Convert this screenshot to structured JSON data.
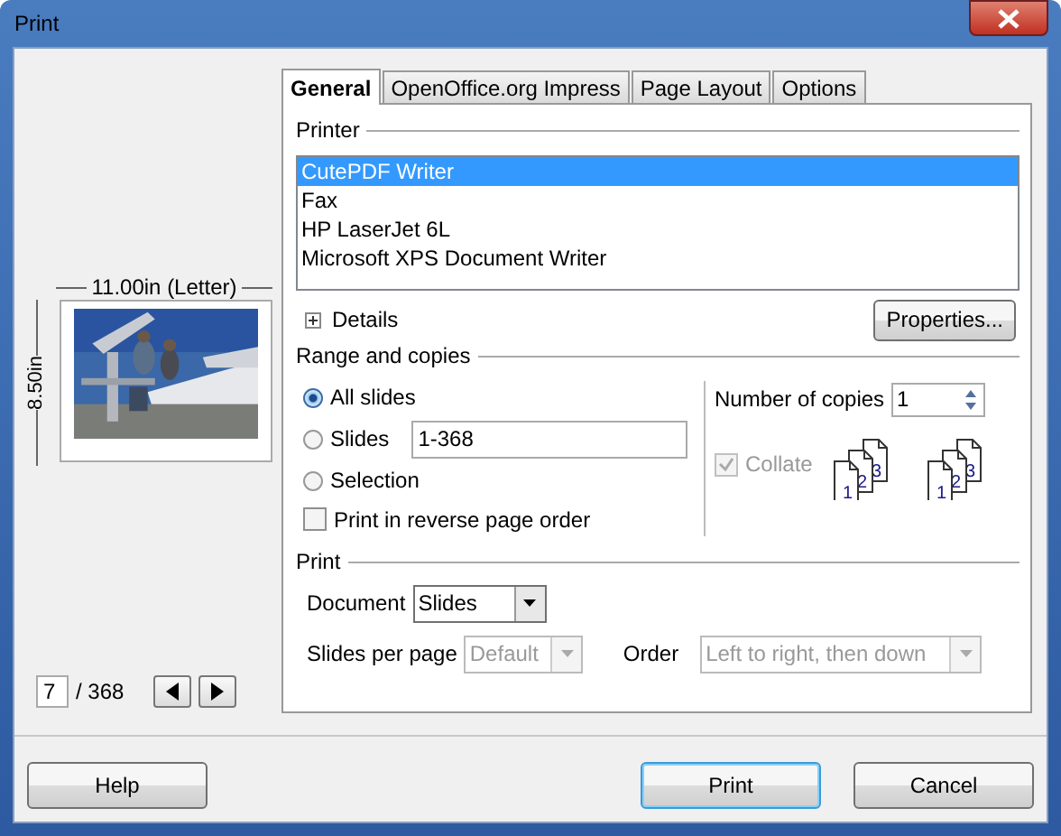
{
  "window": {
    "title": "Print"
  },
  "preview": {
    "width_label": "11.00in (Letter)",
    "height_label": "8.50in",
    "page_number": "7",
    "page_total": "/ 368"
  },
  "tabs": [
    {
      "label": "General",
      "selected": true
    },
    {
      "label": "OpenOffice.org Impress",
      "selected": false
    },
    {
      "label": "Page Layout",
      "selected": false
    },
    {
      "label": "Options",
      "selected": false
    }
  ],
  "printer": {
    "heading": "Printer",
    "printers": [
      {
        "name": "CutePDF Writer",
        "selected": true
      },
      {
        "name": "Fax",
        "selected": false
      },
      {
        "name": "HP LaserJet 6L",
        "selected": false
      },
      {
        "name": "Microsoft XPS Document Writer",
        "selected": false
      }
    ],
    "details": "Details",
    "properties_button": "Properties..."
  },
  "range": {
    "heading": "Range and copies",
    "options": [
      {
        "kind": "radio",
        "label": "All slides",
        "selected": true
      },
      {
        "kind": "radio",
        "label": "Slides",
        "selected": false,
        "value": "1-368"
      },
      {
        "kind": "radio",
        "label": "Selection",
        "selected": false
      },
      {
        "kind": "checkbox",
        "label": "Print in reverse page order",
        "checked": false
      }
    ],
    "copies_label": "Number of copies",
    "copies": "1",
    "collate": {
      "label": "Collate",
      "checked": true,
      "disabled": true
    },
    "collate_icons": [
      {
        "pages": [
          "1",
          "2",
          "3"
        ]
      },
      {
        "pages": [
          "1",
          "2",
          "3"
        ]
      }
    ]
  },
  "print": {
    "heading": "Print",
    "document": {
      "label": "Document",
      "value": "Slides",
      "disabled": false
    },
    "slides_per_page": {
      "label": "Slides per page",
      "value": "Default",
      "disabled": true
    },
    "order": {
      "label": "Order",
      "value": "Left to right, then down",
      "disabled": true
    }
  },
  "buttons": [
    {
      "label": "Help",
      "default": false
    },
    {
      "label": "Print",
      "default": true
    },
    {
      "label": "Cancel",
      "default": false
    }
  ]
}
